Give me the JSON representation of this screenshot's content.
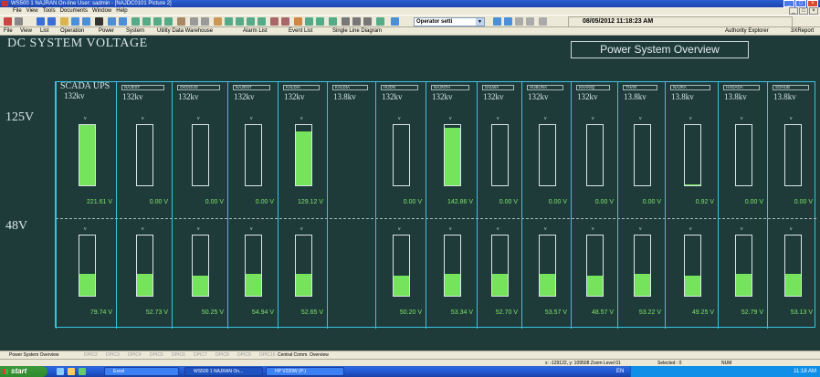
{
  "window": {
    "title": "WS500 1 NAJRAN On-line User: sadmin - [NAJDC0101     Picture 2]",
    "controls": [
      "_",
      "□",
      "×"
    ]
  },
  "menu": {
    "items": [
      "File",
      "View",
      "Tools",
      "Documents",
      "Window",
      "Help"
    ],
    "mdi_controls": [
      "_",
      "□",
      "×"
    ]
  },
  "toolbar": {
    "operator_combo": "Operator setti",
    "datetime": "08/05/2012  11:18:23 AM"
  },
  "toolbar2": {
    "file": "File",
    "view": "View",
    "list": "List",
    "operation": "Operation",
    "power": "Power",
    "system": "System",
    "utility": "Utility Data Warehouse",
    "alarm_list": "Alarm List",
    "event_list": "Event List",
    "single_line": "Single Line Diagram",
    "authority": "Authority Explorer",
    "xreport": "3XReport"
  },
  "main": {
    "title": "DC SYSTEM VOLTAGE",
    "overview_button": "Power System Overview",
    "row_labels": {
      "v125": "125V",
      "v48": "48V"
    },
    "columns": [
      {
        "name": "SCADA UPS",
        "kv": "132kv",
        "v125": "221.61",
        "v48": "79.74",
        "fill125": 1.0,
        "fill48": 0.36
      },
      {
        "name": "NAJEST",
        "kv": "132kv",
        "v125": "0.00",
        "v48": "52.73",
        "fill125": 0,
        "fill48": 0.36
      },
      {
        "name": "OKDOUD",
        "kv": "132kv",
        "v125": "0.00",
        "v48": "50.25",
        "fill125": 0,
        "fill48": 0.34
      },
      {
        "name": "NAJENT",
        "kv": "132kv",
        "v125": "0.00",
        "v48": "54.94",
        "fill125": 0,
        "fill48": 0.37
      },
      {
        "name": "KALDIA",
        "kv": "132kv",
        "v125": "129.12",
        "v48": "52.65",
        "fill125": 0.9,
        "fill48": 0.36
      },
      {
        "name": "KALDIA",
        "kv": "13.8kv",
        "v125": "",
        "v48": "",
        "fill125": -1,
        "fill48": -1
      },
      {
        "name": "HUDN",
        "kv": "132kv",
        "v125": "0.00",
        "v48": "50.20",
        "fill125": 0,
        "fill48": 0.34
      },
      {
        "name": "NAJNTH",
        "kv": "132kv",
        "v125": "142.86",
        "v48": "53.34",
        "fill125": 0.96,
        "fill48": 0.36
      },
      {
        "name": "SALWA",
        "kv": "132kv",
        "v125": "0.00",
        "v48": "52.70",
        "fill125": 0,
        "fill48": 0.36
      },
      {
        "name": "HUBUNA",
        "kv": "132kv",
        "v125": "0.00",
        "v48": "53.57",
        "fill125": 0,
        "fill48": 0.36
      },
      {
        "name": "KHANIQ",
        "kv": "132kv",
        "v125": "0.00",
        "v48": "48.57",
        "fill125": 0,
        "fill48": 0.33
      },
      {
        "name": "THAR",
        "kv": "13.8kv",
        "v125": "0.00",
        "v48": "53.22",
        "fill125": 0,
        "fill48": 0.36
      },
      {
        "name": "NAJRA",
        "kv": "13.8kv",
        "v125": "0.92",
        "v48": "49.25",
        "fill125": 0.01,
        "fill48": 0.33
      },
      {
        "name": "HADADA",
        "kv": "13.8kv",
        "v125": "0.00",
        "v48": "52.79",
        "fill125": 0,
        "fill48": 0.36
      },
      {
        "name": "SOHUB",
        "kv": "13.8kv",
        "v125": "0.00",
        "v48": "53.13",
        "fill125": 0,
        "fill48": 0.36
      }
    ],
    "unit": "V",
    "tick": "v"
  },
  "tabs": {
    "items": [
      "Power System Overview",
      "DPIC2",
      "DPIC3",
      "DPIC4",
      "DPIC5",
      "DPIC6",
      "DPIC7",
      "DPIC8",
      "DPIC9",
      "DPIC10",
      "Central Comm. Overview"
    ],
    "active": [
      0,
      10
    ]
  },
  "status": {
    "coords": "x: -129122, y: 109508  Zoom Level 01",
    "selected": "Selected : 0",
    "num": "NUM"
  },
  "taskbar": {
    "start": "start",
    "tasks": [
      "Excel",
      "WS500 1 NAJRAN On...",
      "HP V220W (P:)"
    ],
    "lang": "EN",
    "clock": "11:18 AM"
  },
  "colors": {
    "background": "#1e3b3a",
    "grid_border": "#39c2e0",
    "bar_fill": "#76e35c",
    "value_text": "#7fe36a"
  }
}
